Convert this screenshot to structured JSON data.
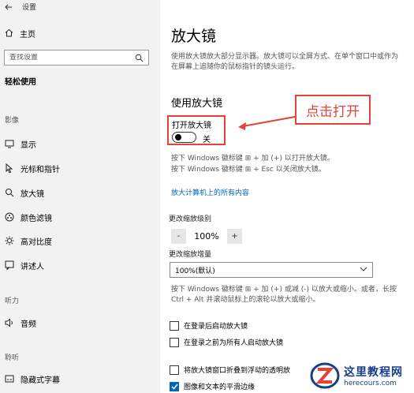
{
  "window": {
    "title": "设置"
  },
  "sidebar": {
    "home_label": "主页",
    "search_placeholder": "查找设置",
    "category_title": "轻松使用",
    "section_vision": "影像",
    "items": [
      {
        "label": "显示",
        "icon": "monitor-icon"
      },
      {
        "label": "光标和指针",
        "icon": "cursor-icon"
      },
      {
        "label": "放大镜",
        "icon": "magnifier-icon"
      },
      {
        "label": "颜色滤镜",
        "icon": "color-filter-icon"
      },
      {
        "label": "高对比度",
        "icon": "contrast-icon"
      },
      {
        "label": "讲述人",
        "icon": "narrator-icon"
      }
    ],
    "section_hearing": "听力",
    "audio_item": "音频",
    "section_interaction": "聆听",
    "caption_item": "隐藏式字幕"
  },
  "main": {
    "title": "放大镜",
    "description": "使用放大镜放大部分显示器。放大镜可以全屏方式、在单个窗口中或作为在屏幕上追随你的鼠标指针的镜头运行。",
    "section_title": "使用放大镜",
    "toggle": {
      "label": "打开放大镜",
      "state": "关",
      "on": false
    },
    "hint_open": "按下 Windows 徽标键 ⊞ + 加 (+) 以打开放大镜。",
    "hint_close": "按下 Windows 徽标键 ⊞ + Esc 以关闭放大镜。",
    "link": "放大计算机上的所有内容",
    "zoom": {
      "label": "更改缩放级别",
      "value": "100%",
      "minus": "-",
      "plus": "+"
    },
    "increment": {
      "label": "更改缩放增量",
      "value": "100%(默认)"
    },
    "zoom_hint": "按下 Windows 徽标键 ⊞ + 加 (+) 或减 (-) 以放大或缩小。或者，长按 Ctrl + Alt 并滚动鼠标上的滚轮以放大或缩小。",
    "checkboxes": [
      {
        "label": "在登录后启动放大镜",
        "checked": false
      },
      {
        "label": "在登录之前为所有人启动放大镜",
        "checked": false
      },
      {
        "label": "将放大镜窗口折叠到浮动的透明放",
        "checked": false
      },
      {
        "label": "图像和文本的平滑边缘",
        "checked": true
      }
    ]
  },
  "annotation": {
    "callout": "点击打开",
    "color": "#e2433a"
  },
  "watermark": {
    "name": "这里教程网",
    "url": "herecours.com"
  },
  "colors": {
    "accent": "#0067b8",
    "sidebar_bg": "#f2f2f2",
    "annotation": "#e2433a"
  }
}
